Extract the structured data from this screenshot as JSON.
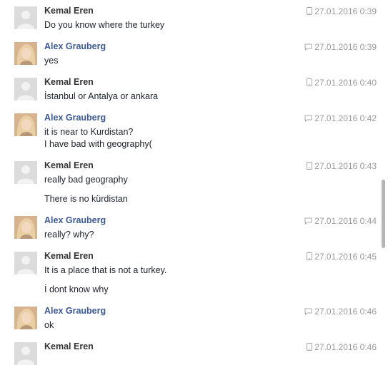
{
  "messages": [
    {
      "author": "Kemal Eren",
      "avatar": "blank",
      "icon": "mobile-icon",
      "time": "27.01.2016 0:39",
      "lines": [
        "Do you know where the turkey"
      ]
    },
    {
      "author": "Alex Grauberg",
      "avatar": "photo",
      "icon": "chat-icon",
      "time": "27.01.2016 0:39",
      "lines": [
        "yes"
      ]
    },
    {
      "author": "Kemal Eren",
      "avatar": "blank",
      "icon": "mobile-icon",
      "time": "27.01.2016 0:40",
      "lines": [
        "İstanbul or Antalya or ankara"
      ]
    },
    {
      "author": "Alex Grauberg",
      "avatar": "photo",
      "icon": "chat-icon",
      "time": "27.01.2016 0:42",
      "lines": [
        "it is near to Kurdistan?",
        "I have bad with geography("
      ]
    },
    {
      "author": "Kemal Eren",
      "avatar": "blank",
      "icon": "mobile-icon",
      "time": "27.01.2016 0:43",
      "lines": [
        "really bad geography",
        "There is no kürdistan"
      ]
    },
    {
      "author": "Alex Grauberg",
      "avatar": "photo",
      "icon": "chat-icon",
      "time": "27.01.2016 0:44",
      "lines": [
        "really? why?"
      ]
    },
    {
      "author": "Kemal Eren",
      "avatar": "blank",
      "icon": "mobile-icon",
      "time": "27.01.2016 0:45",
      "lines": [
        "It is a place that is not a turkey.",
        "İ dont know why"
      ]
    },
    {
      "author": "Alex Grauberg",
      "avatar": "photo",
      "icon": "chat-icon",
      "time": "27.01.2016 0:46",
      "lines": [
        "ok"
      ]
    },
    {
      "author": "Kemal Eren",
      "avatar": "blank",
      "icon": "mobile-icon",
      "time": "27.01.2016 0:46",
      "lines": []
    }
  ]
}
